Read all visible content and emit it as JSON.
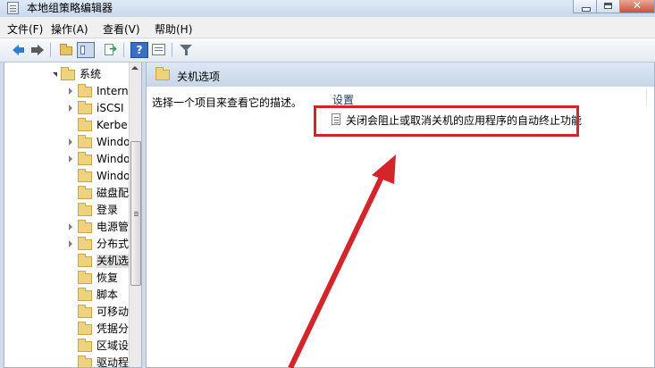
{
  "window": {
    "title": "本地组策略编辑器"
  },
  "menu": [
    "文件(F)",
    "操作(A)",
    "查看(V)",
    "帮助(H)"
  ],
  "tree": {
    "root": "系统",
    "items": [
      {
        "label": "Intern",
        "expandable": true
      },
      {
        "label": "iSCSI",
        "expandable": true
      },
      {
        "label": "Kerbe",
        "expandable": false
      },
      {
        "label": "Windo",
        "expandable": true
      },
      {
        "label": "Windo",
        "expandable": true
      },
      {
        "label": "Windo",
        "expandable": false
      },
      {
        "label": "磁盘配",
        "expandable": false
      },
      {
        "label": "登录",
        "expandable": false
      },
      {
        "label": "电源管",
        "expandable": true
      },
      {
        "label": "分布式",
        "expandable": true
      },
      {
        "label": "关机选",
        "expandable": false,
        "selected": true
      },
      {
        "label": "恢复",
        "expandable": false
      },
      {
        "label": "脚本",
        "expandable": false
      },
      {
        "label": "可移动",
        "expandable": false
      },
      {
        "label": "凭据分",
        "expandable": false
      },
      {
        "label": "区域设",
        "expandable": false
      },
      {
        "label": "驱动程",
        "expandable": false
      }
    ]
  },
  "main": {
    "header_title": "关机选项",
    "description": "选择一个项目来查看它的描述。",
    "column_header": "设置",
    "settings": [
      "关闭会阻止或取消关机的应用程序的自动终止功能"
    ]
  },
  "colors": {
    "highlight": "#d4252b",
    "folder": "#efd27e",
    "header": "#c7d6e8"
  }
}
